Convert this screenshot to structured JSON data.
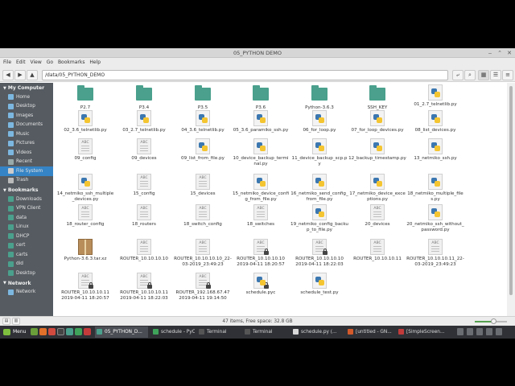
{
  "window": {
    "title": "05_PYTHON DEMO"
  },
  "menubar": [
    "File",
    "Edit",
    "View",
    "Go",
    "Bookmarks",
    "Help"
  ],
  "location": {
    "path": "/data/05_PYTHON_DEMO"
  },
  "sidebar": {
    "my_computer": {
      "heading": "My Computer",
      "items": [
        {
          "label": "Home",
          "icon": "home-icon"
        },
        {
          "label": "Desktop",
          "icon": "desktop-icon"
        },
        {
          "label": "Images",
          "icon": "images-icon"
        },
        {
          "label": "Documents",
          "icon": "documents-icon"
        },
        {
          "label": "Music",
          "icon": "music-icon"
        },
        {
          "label": "Pictures",
          "icon": "pictures-icon"
        },
        {
          "label": "Videos",
          "icon": "videos-icon"
        },
        {
          "label": "Recent",
          "icon": "recent-icon"
        },
        {
          "label": "File System",
          "icon": "file-system-icon"
        },
        {
          "label": "Trash",
          "icon": "trash-icon"
        }
      ]
    },
    "bookmarks": {
      "heading": "Bookmarks",
      "items": [
        {
          "label": "Downloads",
          "icon": "folder-icon"
        },
        {
          "label": "VPN Client",
          "icon": "folder-icon"
        },
        {
          "label": "data",
          "icon": "folder-icon"
        },
        {
          "label": "Linux",
          "icon": "folder-icon"
        },
        {
          "label": "DHCP",
          "icon": "folder-icon"
        },
        {
          "label": "cert",
          "icon": "folder-icon"
        },
        {
          "label": "carts",
          "icon": "folder-icon"
        },
        {
          "label": "did",
          "icon": "folder-icon"
        },
        {
          "label": "Desktop",
          "icon": "folder-icon"
        }
      ]
    },
    "network": {
      "heading": "Network",
      "items": [
        {
          "label": "Network",
          "icon": "network-icon"
        }
      ]
    }
  },
  "files": {
    "row1": [
      {
        "name": "P2.7",
        "type": "folder"
      },
      {
        "name": "P3.4",
        "type": "folder"
      },
      {
        "name": "P3.5",
        "type": "folder"
      },
      {
        "name": "P3.6",
        "type": "folder"
      },
      {
        "name": "Python-3.6.3",
        "type": "folder"
      },
      {
        "name": "SSH_KEY",
        "type": "folder"
      },
      {
        "name": "01_2.7_telnetlib.py",
        "type": "python"
      }
    ],
    "row2": [
      {
        "name": "02_3.6_telnetlib.py",
        "type": "python"
      },
      {
        "name": "03_2.7_telnetlib.py",
        "type": "python"
      },
      {
        "name": "04_3.6_telnetlib.py",
        "type": "python"
      },
      {
        "name": "05_3.6_paramiko_ssh.py",
        "type": "python"
      },
      {
        "name": "06_for_loop.py",
        "type": "python"
      },
      {
        "name": "07_for_loop_devices.py",
        "type": "python"
      },
      {
        "name": "08_list_devices.py",
        "type": "python"
      }
    ],
    "row3": [
      {
        "name": "09_config",
        "type": "text"
      },
      {
        "name": "09_devices",
        "type": "text"
      },
      {
        "name": "09_list_from_file.py",
        "type": "python"
      },
      {
        "name": "10_device_backup_terminal.py",
        "type": "python"
      },
      {
        "name": "11_device_backup_scp.py",
        "type": "python"
      },
      {
        "name": "12_backup_timestamp.py",
        "type": "python"
      },
      {
        "name": "13_netmiko_ssh.py",
        "type": "python"
      }
    ],
    "row4": [
      {
        "name": "14_netmiko_ssh_multiple_devices.py",
        "type": "python"
      },
      {
        "name": "15_config",
        "type": "text"
      },
      {
        "name": "15_devices",
        "type": "text"
      },
      {
        "name": "15_netmiko_device_config_from_file.py",
        "type": "python"
      },
      {
        "name": "16_netmiko_send_config_from_file.py",
        "type": "python"
      },
      {
        "name": "17_netmiko_device_exceptions.py",
        "type": "python"
      },
      {
        "name": "18_netmiko_multiple_files.py",
        "type": "python"
      }
    ],
    "row5": [
      {
        "name": "18_router_config",
        "type": "text"
      },
      {
        "name": "18_routers",
        "type": "text"
      },
      {
        "name": "18_switch_config",
        "type": "text"
      },
      {
        "name": "18_switches",
        "type": "text"
      },
      {
        "name": "19_netmiko_config_backup_to_file.py",
        "type": "python"
      },
      {
        "name": "20_devices",
        "type": "text"
      },
      {
        "name": "20_netmiko_ssh_without_password.py",
        "type": "python"
      }
    ],
    "row6": [
      {
        "name": "Python-3.6.3.tar.xz",
        "type": "archive"
      },
      {
        "name": "ROUTER_10.10.10.10",
        "type": "text"
      },
      {
        "name": "ROUTER_10.10.10.10_22-03-2019_23:49:23",
        "type": "text"
      },
      {
        "name": "ROUTER_10.10.10.10 2019-04-11 18:20:57",
        "type": "text-locked"
      },
      {
        "name": "ROUTER_10.10.10.10 2019-04-11 18:22:03",
        "type": "text-locked"
      },
      {
        "name": "ROUTER_10.10.10.11",
        "type": "text"
      },
      {
        "name": "ROUTER_10.10.10.11_22-03-2019_23:49:23",
        "type": "text"
      }
    ],
    "row7": [
      {
        "name": "ROUTER_10.10.10.11 2019-04-11 18:20:57",
        "type": "text-locked"
      },
      {
        "name": "ROUTER_10.10.10.11 2019-04-11 18:22:03",
        "type": "text-locked"
      },
      {
        "name": "ROUTER_192.168.67.47 2019-04-11 19:14:50",
        "type": "text-locked"
      },
      {
        "name": "schedule.pyc",
        "type": "python-locked"
      },
      {
        "name": "schedule_test.py",
        "type": "python"
      }
    ]
  },
  "status": {
    "text": "47 items, Free space: 32.8 GB",
    "zoom_level": 0.6
  },
  "taskbar": {
    "menu_label": "Menu",
    "tasks": [
      {
        "label": "05_PYTHON_D...",
        "active": true,
        "color": "#4aa08c"
      },
      {
        "label": "schedule - PyC...",
        "active": false,
        "color": "#3fa35a"
      },
      {
        "label": "Terminal",
        "active": false,
        "color": "#555555"
      },
      {
        "label": "Terminal",
        "active": false,
        "color": "#555555"
      },
      {
        "label": "schedule.py (...",
        "active": false,
        "color": "#d9d9d9"
      },
      {
        "label": "[untitled - GN...",
        "active": false,
        "color": "#d35a2b"
      },
      {
        "label": "[SimpleScreen...",
        "active": false,
        "color": "#c23b3b"
      }
    ]
  }
}
